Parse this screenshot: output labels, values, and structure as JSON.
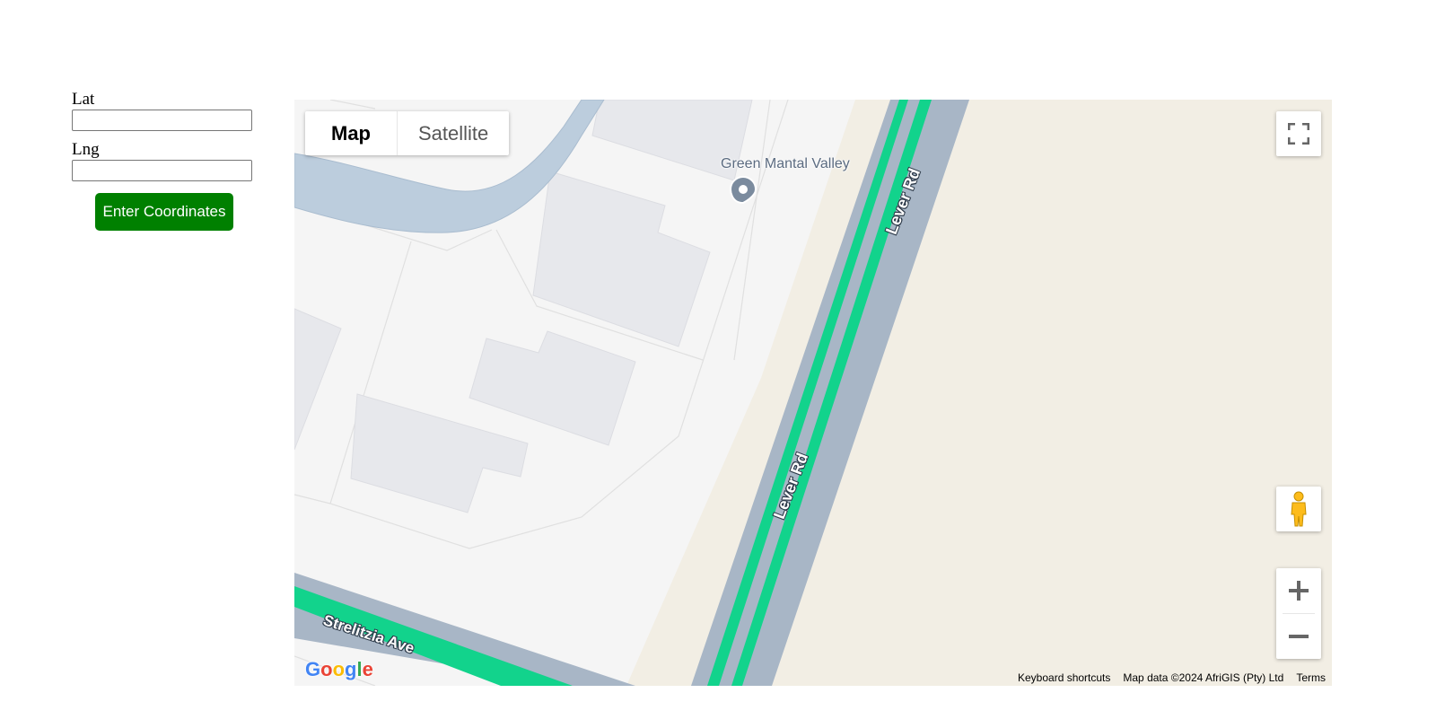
{
  "form": {
    "lat_label": "Lat",
    "lat_value": "",
    "lng_label": "Lng",
    "lng_value": "",
    "submit_label": "Enter Coordinates",
    "submit_color": "#008000"
  },
  "map": {
    "map_type_options": [
      "Map",
      "Satellite"
    ],
    "selected_map_type": "Map",
    "poi_label": "Green Mantal Valley",
    "road_labels": [
      "Lever Rd",
      "Lever Rd",
      "Strelitzia Ave"
    ],
    "footer": {
      "shortcuts": "Keyboard shortcuts",
      "attribution": "Map data ©2024 AfriGIS (Pty) Ltd",
      "terms": "Terms"
    },
    "logo_text": "Google",
    "controls": {
      "fullscreen_icon": "fullscreen-icon",
      "pegman_icon": "pegman-icon",
      "zoom_in_icon": "plus-icon",
      "zoom_out_icon": "minus-icon"
    },
    "colors": {
      "highway_fill": "#12d38c",
      "highway_shoulder": "#a8b6c6",
      "water": "#bccddd",
      "land_beige": "#f2eee4",
      "building": "#e7e8ec"
    }
  }
}
